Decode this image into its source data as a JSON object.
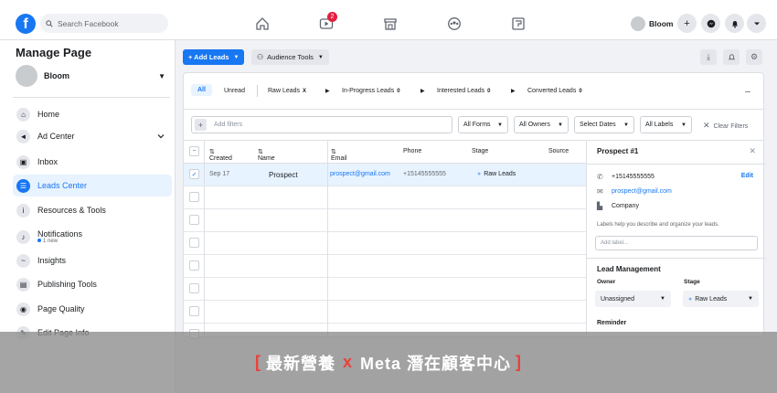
{
  "topbar": {
    "search_placeholder": "Search Facebook",
    "video_badge": "2",
    "profile_name": "Bloom"
  },
  "sidebar": {
    "title": "Manage Page",
    "page_name": "Bloom",
    "items": [
      {
        "label": "Home",
        "icon": "home-icon"
      },
      {
        "label": "Ad Center",
        "icon": "megaphone-icon"
      },
      {
        "label": "Inbox",
        "icon": "inbox-icon"
      },
      {
        "label": "Leads Center",
        "icon": "leads-icon"
      },
      {
        "label": "Resources & Tools",
        "icon": "info-icon"
      },
      {
        "label": "Notifications",
        "icon": "bell-icon",
        "sub": "1 new"
      },
      {
        "label": "Insights",
        "icon": "insights-icon"
      },
      {
        "label": "Publishing Tools",
        "icon": "publishing-icon"
      },
      {
        "label": "Page Quality",
        "icon": "quality-icon"
      },
      {
        "label": "Edit Page Info",
        "icon": "edit-icon"
      }
    ]
  },
  "toolbar": {
    "add_leads": "+ Add Leads",
    "audience_tools": "Audience Tools"
  },
  "tabs": {
    "all": "All",
    "unread": "Unread",
    "raw": "Raw Leads",
    "raw_count": "X",
    "inprogress": "In-Progress Leads",
    "inprogress_count": "0",
    "interested": "Interested Leads",
    "interested_count": "0",
    "converted": "Converted Leads",
    "converted_count": "0",
    "more": "..."
  },
  "filters": {
    "placeholder": "Add filters",
    "all_forms": "All Forms",
    "all_owners": "All Owners",
    "select_dates": "Select Dates",
    "all_labels": "All Labels",
    "clear": "Clear Filters"
  },
  "table": {
    "headers": {
      "created": "Created",
      "name": "Name",
      "email": "Email",
      "phone": "Phone",
      "stage": "Stage",
      "source": "Source"
    },
    "rows": [
      {
        "created": "Sep 17",
        "name": "Prospect",
        "email": "prospect@gmail.com",
        "phone": "+15145555555",
        "stage": "Raw Leads"
      }
    ]
  },
  "detail": {
    "title": "Prospect #1",
    "phone": "+15145555555",
    "edit": "Edit",
    "email": "prospect@gmail.com",
    "company": "Company",
    "labels_help": "Labels help you describe and organize your leads.",
    "label_placeholder": "Add label...",
    "lead_mgmt": "Lead Management",
    "owner_label": "Owner",
    "stage_label": "Stage",
    "owner_value": "Unassigned",
    "stage_value": "Raw Leads",
    "reminder": "Reminder"
  },
  "banner": {
    "open": "[",
    "text1": "最新營養",
    "x": "x",
    "text2": "Meta 潛在顧客中心",
    "close": "]"
  }
}
